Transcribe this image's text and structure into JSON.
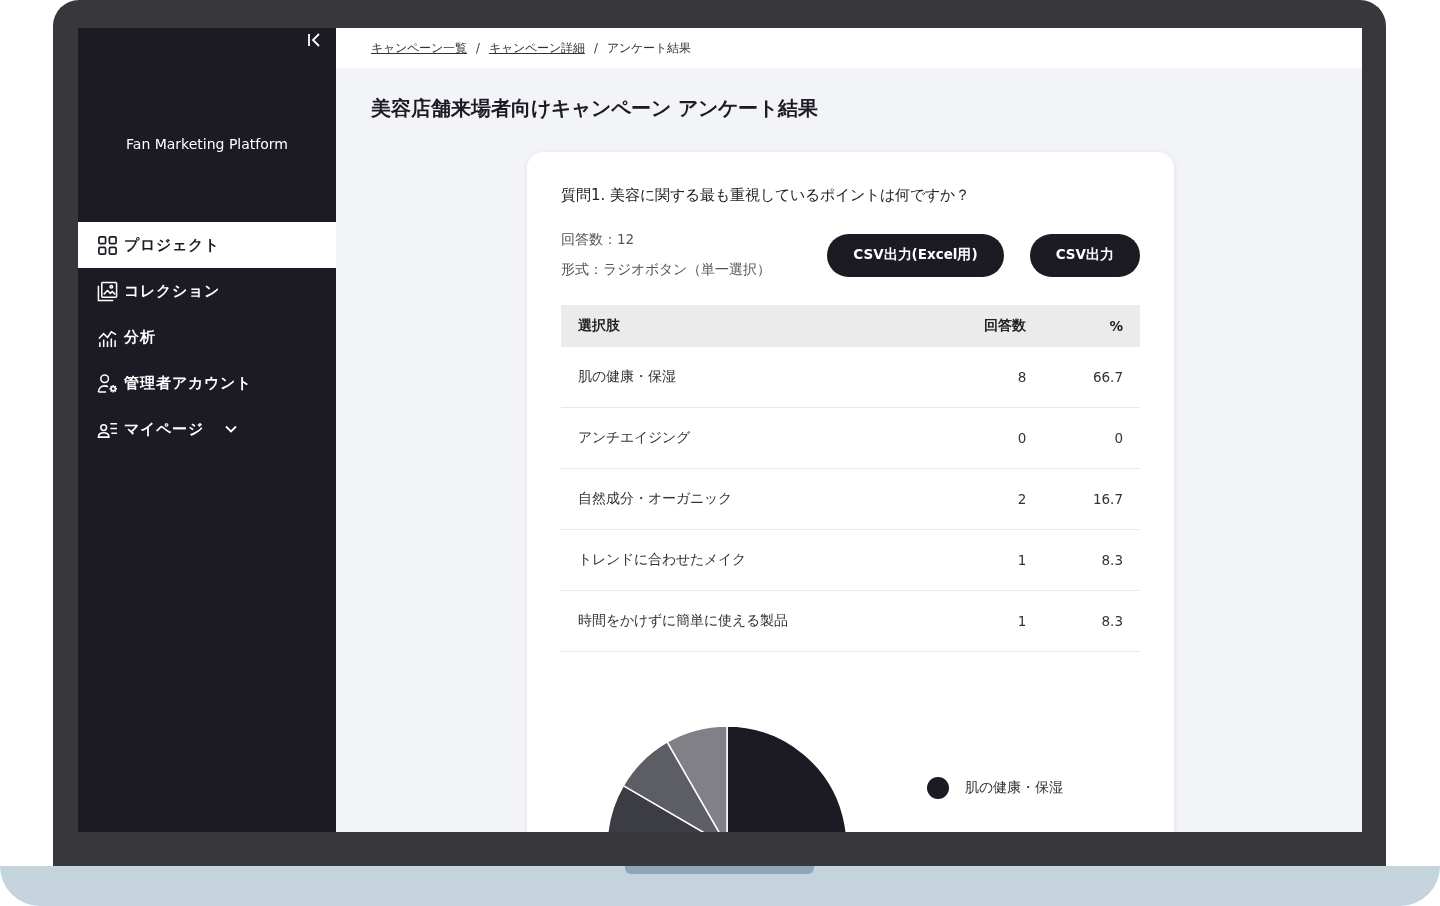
{
  "sidebar": {
    "logo": "Fan Marketing Platform",
    "items": [
      {
        "label": "プロジェクト",
        "kind": "grid",
        "selected": true
      },
      {
        "label": "コレクション",
        "kind": "gallery",
        "selected": false
      },
      {
        "label": "分析",
        "kind": "chart",
        "selected": false
      },
      {
        "label": "管理者アカウント",
        "kind": "admin",
        "selected": false
      },
      {
        "label": "マイページ",
        "kind": "user",
        "selected": false,
        "expandable": true
      }
    ]
  },
  "breadcrumb": [
    {
      "label": "キャンペーン一覧",
      "link": true
    },
    {
      "label": "キャンペーン詳細",
      "link": true
    },
    {
      "label": "アンケート結果",
      "link": false
    }
  ],
  "breadcrumb_separator": "/",
  "page_title": "美容店舗来場者向けキャンペーン アンケート結果",
  "question": {
    "title": "質問1. 美容に関する最も重視しているポイントは何ですか？",
    "answers": "回答数：12",
    "format": "形式：ラジオボタン（単一選択）",
    "buttons": [
      "CSV出力(Excel用)",
      "CSV出力"
    ],
    "table": {
      "columns": [
        "選択肢",
        "回答数",
        "%"
      ],
      "rows": [
        [
          "肌の健康・保湿",
          "8",
          "66.7"
        ],
        [
          "アンチエイジング",
          "0",
          "0"
        ],
        [
          "自然成分・オーガニック",
          "2",
          "16.7"
        ],
        [
          "トレンドに合わせたメイク",
          "1",
          "8.3"
        ],
        [
          "時間をかけずに簡単に使える製品",
          "1",
          "8.3"
        ]
      ]
    },
    "chart": {
      "chart_data": {
        "type": "pie",
        "values": [
          66.7,
          16.7,
          8.3,
          8.3
        ],
        "colors": [
          "#1c1b24",
          "#3c3c45",
          "#5d5d65",
          "#808086"
        ]
      },
      "legend": [
        {
          "label": "肌の健康・保湿",
          "color": "#1c1b24"
        }
      ]
    }
  }
}
